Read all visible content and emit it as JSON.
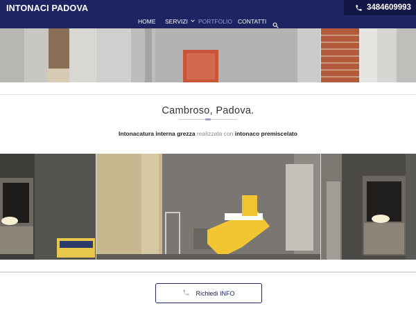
{
  "header": {
    "brand": "INTONACI PADOVA",
    "phone": "3484609993"
  },
  "nav": {
    "items": [
      {
        "label": "HOME"
      },
      {
        "label": "SERVIZI"
      },
      {
        "label": "PORTFOLIO"
      },
      {
        "label": "CONTATTI"
      }
    ],
    "active": "PORTFOLIO"
  },
  "main": {
    "title": "Cambroso, Padova.",
    "description": {
      "part1": "Intonacatura interna grezza",
      "part2": " realizzata con ",
      "part3": "intonaco premiscelato"
    },
    "cta_label": "Richiedi INFO"
  },
  "colors": {
    "header_bg": "#1d2461",
    "phone_bg": "#121644",
    "accent": "#1d2461",
    "active_nav": "#8fa0d8"
  },
  "icons": [
    "phone-icon",
    "chevron-down-icon",
    "search-icon",
    "phone-icon"
  ]
}
